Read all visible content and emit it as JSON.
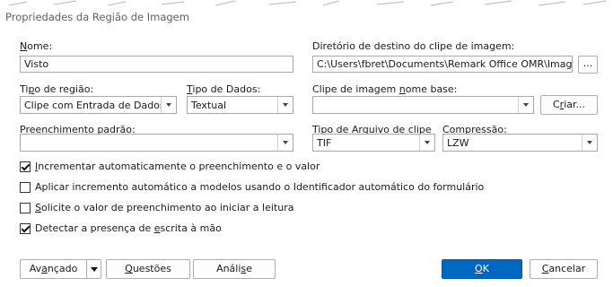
{
  "window": {
    "title": "Propriedades da Região de Imagem"
  },
  "fields": {
    "nome": {
      "label_pre": "",
      "label_u": "N",
      "label_post": "ome:",
      "value": "Visto"
    },
    "diretorio": {
      "label": "Diretório de destino do clipe de imagem:",
      "value": "C:\\Users\\fbret\\Documents\\Remark Office OMR\\Images",
      "browse_label": "..."
    },
    "tipo_regiao": {
      "label_pre": "Ti",
      "label_u": "p",
      "label_post": "o de região:",
      "value": "Clipe com Entrada de Dados"
    },
    "tipo_dados": {
      "label_pre": "",
      "label_u": "T",
      "label_post": "ipo de Dados:",
      "value": "Textual"
    },
    "clipe_nome_base": {
      "label_pre": "Clipe de imagem ",
      "label_u": "n",
      "label_post": "ome base:",
      "value": "",
      "criar_pre": "C",
      "criar_u": "r",
      "criar_post": "iar..."
    },
    "preenchimento": {
      "label_pre": "Preenchimento ",
      "label_u": "p",
      "label_post": "adrão:",
      "value": ""
    },
    "tipo_arquivo": {
      "label_pre": "Ti",
      "label_u": "p",
      "label_post": "o de Arquivo de clipe",
      "value": "TIF"
    },
    "compressao": {
      "label_pre": "Comp",
      "label_u": "r",
      "label_post": "essão:",
      "value": "LZW"
    }
  },
  "checkboxes": [
    {
      "pre": "",
      "u": "I",
      "post": "ncrementar automaticamente o preenchimento e o valor",
      "checked": true
    },
    {
      "pre": "Aplicar incremento automático a modelos usando o Identificador automático do formulário",
      "u": "",
      "post": "",
      "checked": false
    },
    {
      "pre": "",
      "u": "S",
      "post": "olicite o valor de preenchimento ao iniciar a leitura",
      "checked": false
    },
    {
      "pre": "Detectar a presença de ",
      "u": "e",
      "post": "scrita à mão",
      "checked": true
    }
  ],
  "buttons": {
    "avancado": {
      "pre": "Av",
      "u": "a",
      "post": "nçado"
    },
    "questoes": {
      "pre": "",
      "u": "Q",
      "post": "uestões"
    },
    "analise": {
      "pre": "Análi",
      "u": "s",
      "post": "e"
    },
    "ok": {
      "pre": "",
      "u": "O",
      "post": "K"
    },
    "cancelar": {
      "pre": "",
      "u": "C",
      "post": "ancelar"
    }
  }
}
